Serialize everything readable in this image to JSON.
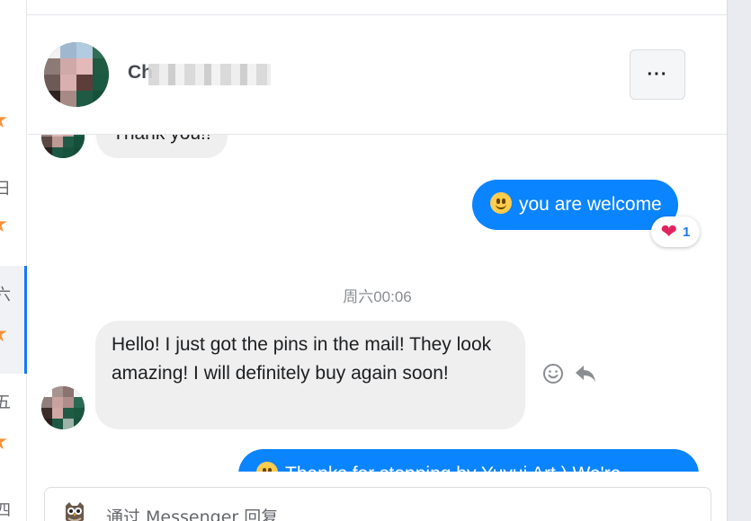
{
  "sidebar": {
    "items": [
      {
        "day": "",
        "starred": true
      },
      {
        "day": "日",
        "starred": true
      },
      {
        "day": "六",
        "starred": true,
        "active": true
      },
      {
        "day": "五",
        "starred": true
      },
      {
        "day": "四",
        "starred": false
      }
    ]
  },
  "header": {
    "contact_name": "Ch",
    "more_label": "···"
  },
  "messages": {
    "prev_incoming": "Thank you!!",
    "outgoing_1": "you are welcome",
    "reaction_count": "1",
    "timestamp": "周六00:06",
    "incoming_2": "Hello! I just got the pins in the mail! They look amazing! I will definitely buy again soon!",
    "outgoing_2": "Thanks for stopping by Yuyui Art ) We're"
  },
  "composer": {
    "placeholder": "通过 Messenger 回复"
  },
  "colors": {
    "outgoing_bubble": "#0a84ff",
    "incoming_bubble": "#efefef",
    "star": "#f7923b",
    "active_indicator": "#1877f2"
  },
  "icons": [
    "star-icon",
    "more-icon",
    "heart-icon",
    "smiley-icon",
    "reply-icon",
    "owl-icon"
  ]
}
